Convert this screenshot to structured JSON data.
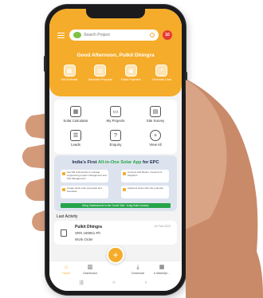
{
  "search": {
    "placeholder": "Search Project"
  },
  "notifications": {
    "count": "10"
  },
  "greeting": "Good Afternoon, Pulkit Dhingra",
  "quick_actions": [
    {
      "label": "Site Estimate",
      "icon": "estimate-icon"
    },
    {
      "label": "Generate Proposal",
      "icon": "proposal-icon"
    },
    {
      "label": "Raise Payment",
      "icon": "payment-icon"
    },
    {
      "label": "Generate Lead",
      "icon": "add-lead-icon"
    }
  ],
  "grid": [
    {
      "label": "Solar Calculator",
      "icon": "calculator-icon"
    },
    {
      "label": "My Projects",
      "icon": "folder-icon"
    },
    {
      "label": "Site Survey",
      "icon": "survey-icon"
    },
    {
      "label": "Leads",
      "icon": "leads-icon"
    },
    {
      "label": "Enquiry",
      "icon": "enquiry-icon"
    },
    {
      "label": "View All",
      "icon": "plus-icon"
    }
  ],
  "banner": {
    "title_prefix": "India's First ",
    "title_highlight": "All-in-One Solar App",
    "title_suffix": " for EPC",
    "features": [
      "Get Rid of Excel file to manage engineering project management and Site Management",
      "Connect with Banks, Investors & Suppliers",
      "Create quick solar proposals and seamless",
      "Upload & share with site proposal"
    ],
    "strip": "Bring Solarkonnect to the Cloud! Visit : b-dig-Solar Industry"
  },
  "last_activity": {
    "title": "Last Activity",
    "name": "Pulkit Dhingra",
    "srn": "SRN 198961-Ph",
    "type": "Work Order",
    "date": "10-Feb-2023"
  },
  "bottom_nav": [
    {
      "label": "Home",
      "icon": "home-icon",
      "active": true
    },
    {
      "label": "Dashboard",
      "icon": "dashboard-icon",
      "active": false
    },
    {
      "label": "Download",
      "icon": "download-icon",
      "active": false
    },
    {
      "label": "e-Marketpl...",
      "icon": "marketplace-icon",
      "active": false
    }
  ],
  "fab": {
    "label": "+"
  },
  "colors": {
    "brand": "#f5ac2a",
    "accent_green": "#26a44a",
    "notif": "#e53935"
  }
}
